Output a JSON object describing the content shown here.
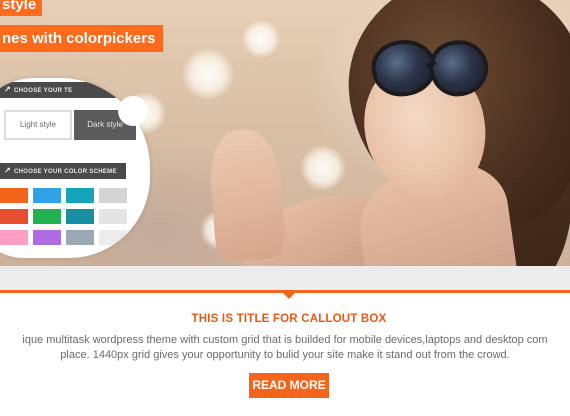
{
  "hero": {
    "headline_top": "style",
    "headline_main": "nes with colorpickers",
    "switcher": {
      "style_section_label": "CHOOSE YOUR TE",
      "light_style_label": "Light style",
      "dark_style_label": "Dark style",
      "color_section_label": "CHOOSE YOUR COLOR SCHEME",
      "swatches": [
        "#f26419",
        "#2fa3e6",
        "#14a3b7",
        "#d4d4d4",
        "#e84f2f",
        "#23b14d",
        "#168fa1",
        "#e4e4e4",
        "#ff9ec4",
        "#b16be0",
        "#9aa8b4",
        "#ececec"
      ]
    }
  },
  "callout": {
    "title": "THIS IS TITLE FOR CALLOUT BOX",
    "text_line1": "ique multitask wordpress theme with custom grid that is builded for mobile devices,laptops and desktop com",
    "text_line2": "place. 1440px grid gives your opportunity to bulid your site make it stand out from the crowd.",
    "button_label": "READ MORE"
  },
  "colors": {
    "accent": "#f4641a",
    "title": "#e65a16",
    "body_text": "#6b6b6b"
  }
}
